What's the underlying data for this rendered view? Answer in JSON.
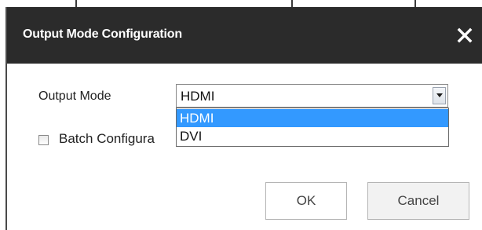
{
  "dialog": {
    "title": "Output Mode Configuration",
    "close_icon": "close-icon"
  },
  "form": {
    "output_mode_label": "Output Mode",
    "output_mode_value": "HDMI",
    "output_mode_options": [
      "HDMI",
      "DVI"
    ],
    "output_mode_highlighted": "HDMI",
    "batch_label": "Batch Configura",
    "batch_checked": false
  },
  "buttons": {
    "ok": "OK",
    "cancel": "Cancel"
  },
  "colors": {
    "titlebar": "#2b2b2b",
    "selection": "#3399ff"
  }
}
